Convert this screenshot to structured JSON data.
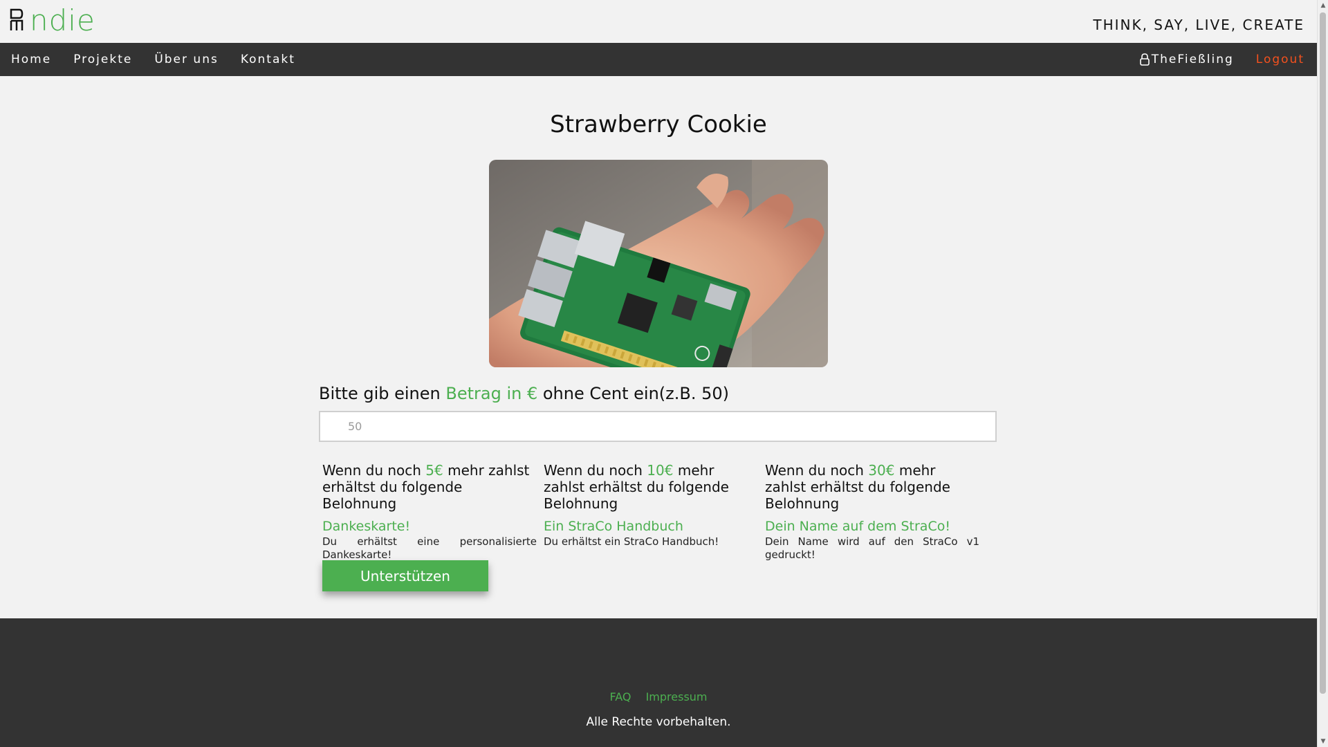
{
  "header": {
    "logo_text": "ndie",
    "tagline": "THINK, SAY, LIVE, CREATE"
  },
  "nav": {
    "items": [
      {
        "label": "Home"
      },
      {
        "label": "Projekte"
      },
      {
        "label": "Über uns"
      },
      {
        "label": "Kontakt"
      }
    ],
    "user": "TheFießling",
    "logout": "Logout"
  },
  "project": {
    "title": "Strawberry Cookie",
    "image_icon": "raspberry-pi-in-hand-photo"
  },
  "form": {
    "prompt_pre": "Bitte gib einen ",
    "prompt_highlight": "Betrag in €",
    "prompt_post": " ohne Cent ein(z.B. 50)",
    "placeholder": "50",
    "submit_label": "Unterstützen"
  },
  "rewards": [
    {
      "head_pre": "Wenn du noch ",
      "amount": "5€",
      "head_post": " mehr zahlst erhältst du folgende Belohnung",
      "title": "Dankeskarte!",
      "desc": "Du erhältst eine personalisierte Dankeskarte!"
    },
    {
      "head_pre": "Wenn du noch ",
      "amount": "10€",
      "head_post": " mehr zahlst erhältst du folgende Belohnung",
      "title": "Ein StraCo Handbuch",
      "desc": "Du erhältst ein StraCo Handbuch!"
    },
    {
      "head_pre": "Wenn du noch ",
      "amount": "30€",
      "head_post": " mehr zahlst erhältst du folgende Belohnung",
      "title": "Dein Name auf dem StraCo!",
      "desc": "Dein Name wird auf den StraCo v1 gedruckt!"
    }
  ],
  "footer": {
    "links": [
      {
        "label": "FAQ"
      },
      {
        "label": "Impressum"
      }
    ],
    "copyright": "Alle Rechte vorbehalten."
  },
  "colors": {
    "accent": "#4caf50",
    "nav_bg": "#333333",
    "logout": "#f4511e",
    "page_bg": "#f2f2f2"
  }
}
